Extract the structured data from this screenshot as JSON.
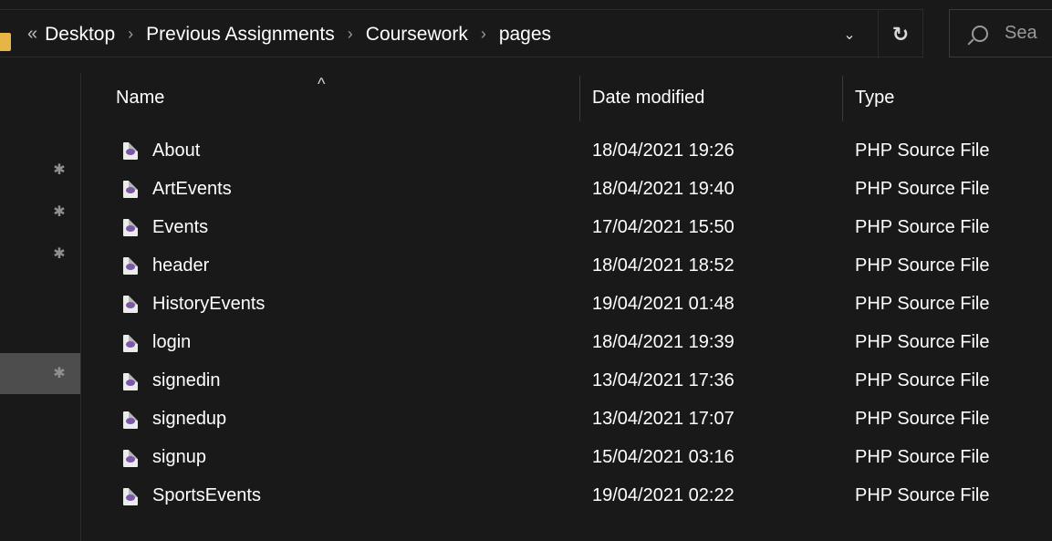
{
  "address_bar": {
    "overflow": "«",
    "separator": "›",
    "crumbs": [
      "Desktop",
      "Previous Assignments",
      "Coursework",
      "pages"
    ],
    "dropdown_glyph": "⌄",
    "refresh_glyph": "↻"
  },
  "search": {
    "placeholder": "Sea"
  },
  "columns": {
    "name": "Name",
    "date_modified": "Date modified",
    "type": "Type",
    "sort_indicator": "^"
  },
  "nav_pane": {
    "pins": [
      "pin-icon",
      "pin-icon",
      "pin-icon",
      "pin-icon"
    ],
    "pin_glyph": "✱"
  },
  "files": [
    {
      "name": "About",
      "date": "18/04/2021 19:26",
      "type": "PHP Source File"
    },
    {
      "name": "ArtEvents",
      "date": "18/04/2021 19:40",
      "type": "PHP Source File"
    },
    {
      "name": "Events",
      "date": "17/04/2021 15:50",
      "type": "PHP Source File"
    },
    {
      "name": "header",
      "date": "18/04/2021 18:52",
      "type": "PHP Source File"
    },
    {
      "name": "HistoryEvents",
      "date": "19/04/2021 01:48",
      "type": "PHP Source File"
    },
    {
      "name": "login",
      "date": "18/04/2021 19:39",
      "type": "PHP Source File"
    },
    {
      "name": "signedin",
      "date": "13/04/2021 17:36",
      "type": "PHP Source File"
    },
    {
      "name": "signedup",
      "date": "13/04/2021 17:07",
      "type": "PHP Source File"
    },
    {
      "name": "signup",
      "date": "15/04/2021 03:16",
      "type": "PHP Source File"
    },
    {
      "name": "SportsEvents",
      "date": "19/04/2021 02:22",
      "type": "PHP Source File"
    }
  ],
  "colors": {
    "background": "#191919",
    "nav_selected": "#4d4d4d",
    "folder": "#e7b546",
    "php_icon_accent": "#7d58a8"
  }
}
